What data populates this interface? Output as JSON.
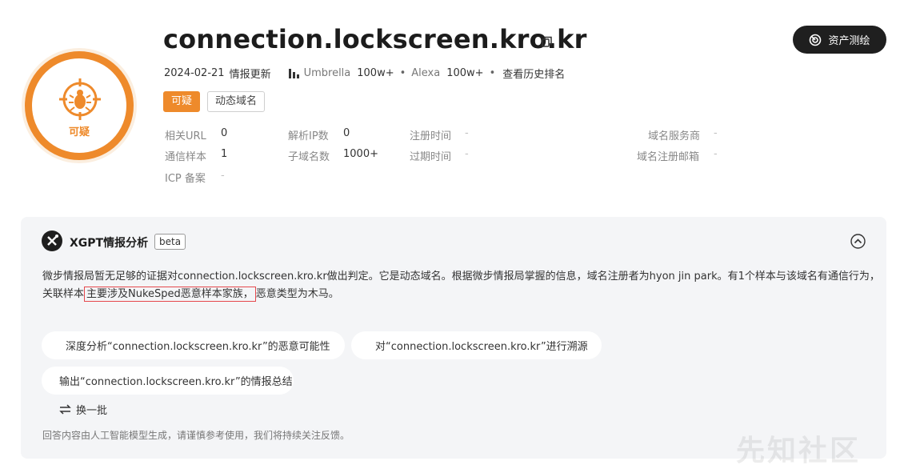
{
  "domain": {
    "name": "connection.lockscreen.kro.kr"
  },
  "verdict_badge": {
    "label": "可疑",
    "icon": "bug-target-icon",
    "color": "#ee8a2b"
  },
  "meta": {
    "date": "2024-02-21",
    "updated_label": "情报更新",
    "umbrella_label": "Umbrella",
    "umbrella_rank": "100w+",
    "alexa_label": "Alexa",
    "alexa_rank": "100w+",
    "history_link": "查看历史排名"
  },
  "tags": {
    "suspicious": "可疑",
    "dynamic": "动态域名"
  },
  "info": {
    "related_url_label": "相关URL",
    "related_url_value": "0",
    "resolved_ip_label": "解析IP数",
    "resolved_ip_value": "0",
    "register_time_label": "注册时间",
    "register_time_value": "-",
    "registrar_label": "域名服务商",
    "registrar_value": "-",
    "samples_label": "通信样本",
    "samples_value": "1",
    "subdomains_label": "子域名数",
    "subdomains_value": "1000+",
    "expire_time_label": "过期时间",
    "expire_time_value": "-",
    "registrant_email_label": "域名注册邮箱",
    "registrant_email_value": "-",
    "icp_label": "ICP 备案",
    "icp_value": "-"
  },
  "asset_button": {
    "label": "资产测绘"
  },
  "xgpt": {
    "title": "XGPT情报分析",
    "beta": "beta",
    "analysis_line1": "微步情报局暂无足够的证据对connection.lockscreen.kro.kr做出判定。它是动态域名。根据微步情报局掌握的信息，域名注册者为hyon jin park。有1个样本与该域名有通信行为，",
    "analysis_line2_pre": "关联样本",
    "analysis_line2_highlight": "主要涉及NukeSped恶意样本家族，",
    "analysis_line2_post": "恶意类型为木马。",
    "suggestions": [
      "深度分析“connection.lockscreen.kro.kr”的恶意可能性",
      "对“connection.lockscreen.kro.kr”进行溯源",
      "输出“connection.lockscreen.kro.kr”的情报总结"
    ],
    "refresh_label": "换一批",
    "disclaimer": "回答内容由人工智能模型生成，请谨慎参考使用，我们将持续关注反馈。"
  },
  "watermark": "先知社区",
  "colors": {
    "accent_orange": "#ee8a2b",
    "highlight_red": "#e5484d",
    "dark_button": "#1f1f1f"
  }
}
